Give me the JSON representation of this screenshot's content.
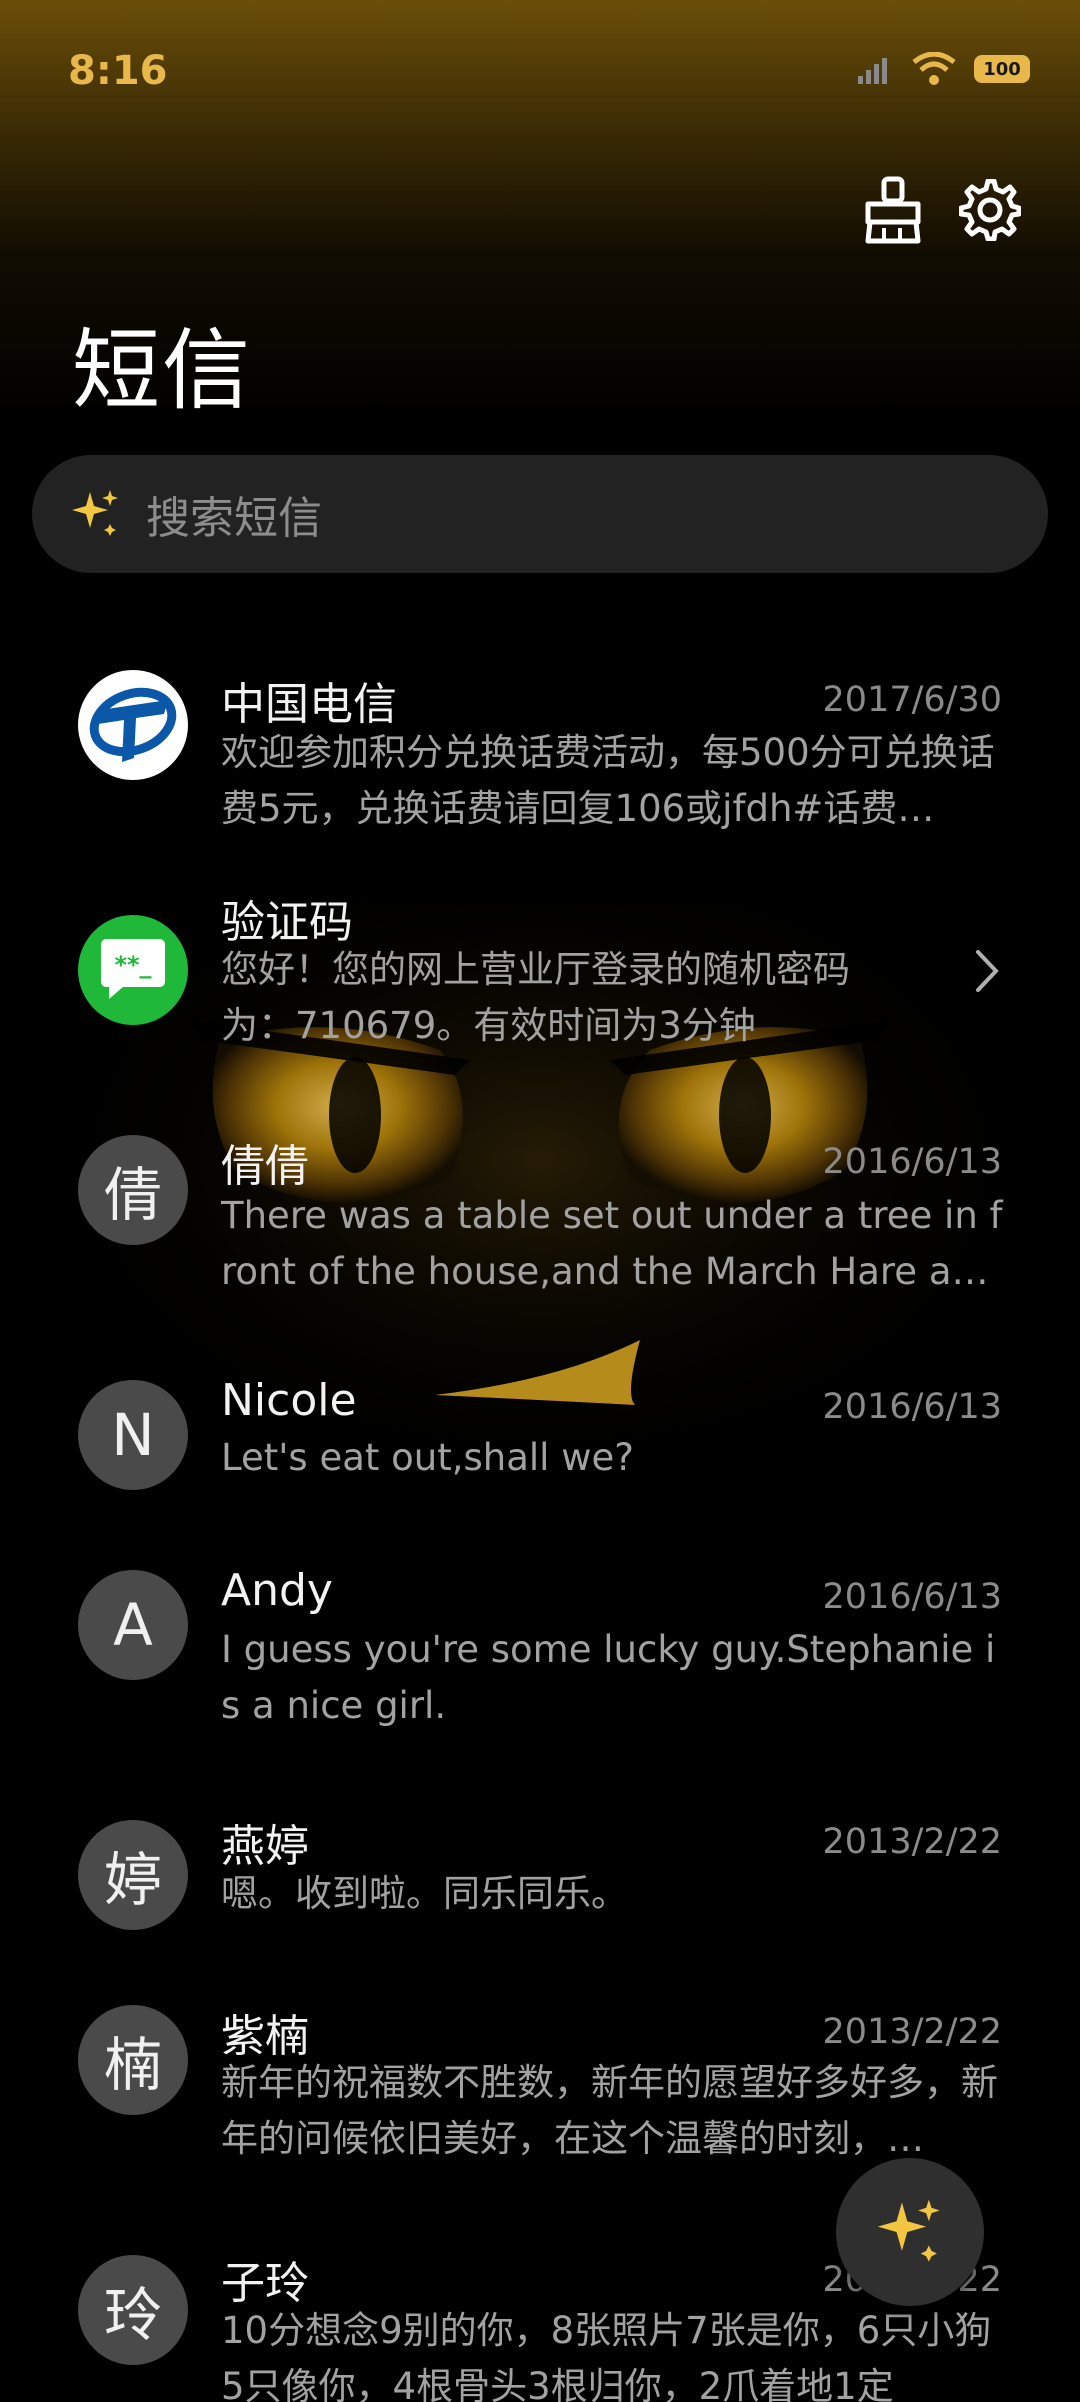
{
  "status": {
    "time": "8:16",
    "battery": "100"
  },
  "header": {
    "title": "短信"
  },
  "search": {
    "placeholder": "搜索短信"
  },
  "messages": [
    {
      "name": "中国电信",
      "date": "2017/6/30",
      "preview": "欢迎参加积分兑换话费活动，每500分可兑换话费5元，兑换话费请回复106或jfdh#话费…",
      "avatar_type": "china-telecom-logo"
    },
    {
      "name": "验证码",
      "date": "",
      "preview": "您好！您的网上营业厅登录的随机密码为：710679。有效时间为3分钟",
      "avatar_type": "verification-code-icon",
      "avatar_glyph": "**_"
    },
    {
      "name": "倩倩",
      "date": "2016/6/13",
      "preview": "There was a table set out under a tree in front of the house,and the March Hare an…",
      "avatar_letter": "倩"
    },
    {
      "name": "Nicole",
      "date": "2016/6/13",
      "preview": "Let's eat out,shall we?",
      "avatar_letter": "N"
    },
    {
      "name": "Andy",
      "date": "2016/6/13",
      "preview": "I guess you're some lucky guy.Stephanie is a nice girl.",
      "avatar_letter": "A"
    },
    {
      "name": "燕婷",
      "date": "2013/2/22",
      "preview": "嗯。收到啦。同乐同乐。",
      "avatar_letter": "婷"
    },
    {
      "name": "紫楠",
      "date": "2013/2/22",
      "preview": "新年的祝福数不胜数，新年的愿望好多好多，新年的问候依旧美好，在这个温馨的时刻，…",
      "avatar_letter": "楠"
    },
    {
      "name": "子玲",
      "date": "2013/2/22",
      "preview": "10分想念9别的你，8张照片7张是你，6只小狗5只像你，4根骨头3根归你，2爪着地1定",
      "avatar_letter": "玲"
    }
  ],
  "colors": {
    "accent": "#e8b84a",
    "background": "#000000",
    "verification_green": "#1fb838",
    "telecom_blue": "#0b57a8"
  },
  "icons": {
    "clean": "broom-icon",
    "settings": "gear-icon",
    "search": "sparkle-icon",
    "fab": "sparkle-icon"
  }
}
